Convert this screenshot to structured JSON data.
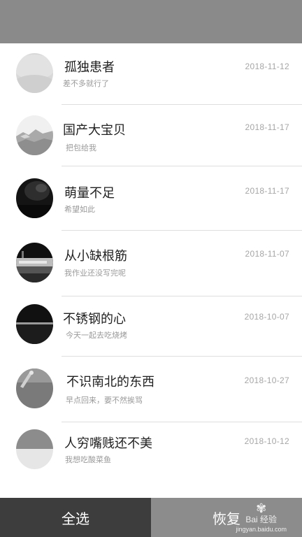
{
  "contacts": [
    {
      "name": "孤独患者",
      "message": "差不多就行了",
      "date": "2018-11-12"
    },
    {
      "name": "国产大宝贝",
      "message": "把包给我",
      "date": "2018-11-17"
    },
    {
      "name": "萌量不足",
      "message": "希望如此",
      "date": "2018-11-17"
    },
    {
      "name": "从小缺根筋",
      "message": "我作业还没写完呢",
      "date": "2018-11-07"
    },
    {
      "name": "不锈钢的心",
      "message": "今天一起去吃烧烤",
      "date": "2018-10-07"
    },
    {
      "name": "不识南北的东西",
      "message": "早点回来，要不然挨骂",
      "date": "2018-10-27"
    },
    {
      "name": "人穷嘴贱还不美",
      "message": "我想吃酸菜鱼",
      "date": "2018-10-12"
    }
  ],
  "bottom": {
    "select_all_label": "全选",
    "restore_label": "恢复"
  },
  "watermark": {
    "text": "Bai 经验",
    "url": "jingyan.baidu.com"
  }
}
